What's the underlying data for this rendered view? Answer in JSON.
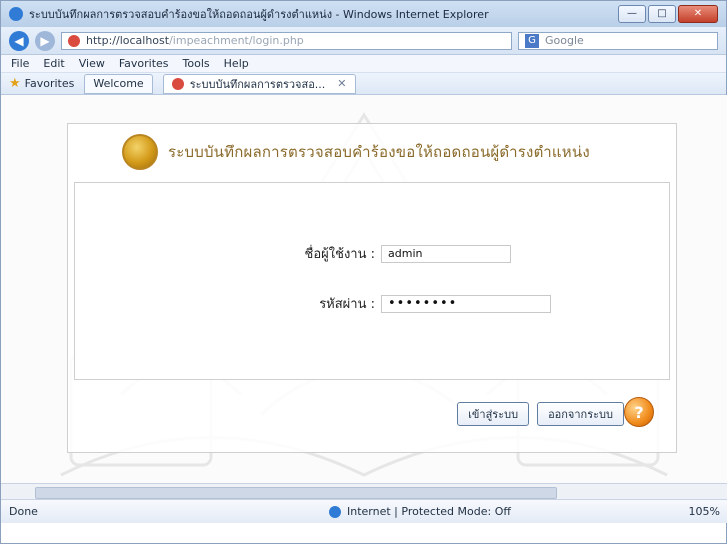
{
  "browser": {
    "title": "ระบบบันทึกผลการตรวจสอบคำร้องขอให้ถอดถอนผู้ดำรงตำแหน่ง - Windows Internet Explorer",
    "address_url": "http://localhost/impeachment/login.php",
    "address_url_prefix": "http://",
    "address_url_host": "localhost",
    "address_url_path": "/impeachment/login.php",
    "search_placeholder": "Google",
    "menu": [
      "File",
      "Edit",
      "View",
      "Favorites",
      "Tools",
      "Help"
    ],
    "favorites_label": "Favorites",
    "tabs": [
      {
        "label": "Welcome"
      },
      {
        "label": "ระบบบันทึกผลการตรวจสอ..."
      }
    ],
    "status_left": "Done",
    "status_mid": "Internet | Protected Mode: Off",
    "zoom": "105%"
  },
  "page": {
    "header_title": "ระบบบันทึกผลการตรวจสอบคำร้องขอให้ถอดถอนผู้ดำรงตำแหน่ง",
    "username_label": "ชื่อผู้ใช้งาน :",
    "username_value": "admin",
    "password_label": "รหัสผ่าน :",
    "password_mask": "••••••••",
    "login_button": "เข้าสู่ระบบ",
    "logout_button": "ออกจากระบบ",
    "help_label": "?"
  },
  "icons": {
    "browser": "ie-icon",
    "back": "back-arrow-icon",
    "forward": "forward-arrow-icon",
    "favicon": "site-favicon-icon",
    "search_engine": "google-search-icon",
    "favorites": "star-icon",
    "globe": "internet-zone-icon",
    "help": "help-icon"
  }
}
